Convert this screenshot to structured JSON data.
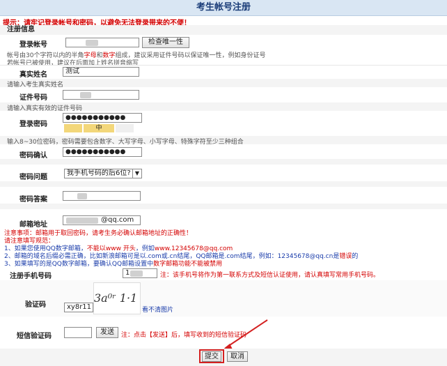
{
  "header": {
    "title": "考生帐号注册"
  },
  "tip": "提示：请牢记登录帐号和密码，以避免无法登录带来的不便！",
  "section_title": "注册信息",
  "account": {
    "label": "登录帐号",
    "check_button": "检查唯一性",
    "hint_line1_a": "帐号由30个字符以内的半角",
    "hint_line1_b": "字母",
    "hint_line1_c": "和",
    "hint_line1_d": "数字",
    "hint_line1_e": "组成，建议采用证件号码以保证唯一性，例如身份证号",
    "hint_line2": "若帐号已被使用，建议在后面加上姓名拼音缩写"
  },
  "realname": {
    "label": "真实姓名",
    "value": "测试",
    "hint": "请输入考生真实姓名"
  },
  "idnum": {
    "label": "证件号码",
    "hint": "请输入真实有效的证件号码"
  },
  "password": {
    "label": "登录密码",
    "value": "●●●●●●●●●●●",
    "strength": "中",
    "hint": "输入8~30位密码，密码需要包含数字、大写字母、小写字母、特殊字符至少三种组合"
  },
  "password_confirm": {
    "label": "密码确认",
    "value": "●●●●●●●●●●●"
  },
  "question": {
    "label": "密码问题",
    "selected": "我手机号码的后6位?"
  },
  "answer": {
    "label": "密码答案"
  },
  "email": {
    "label": "邮箱地址",
    "value": "@qq.com"
  },
  "notes": {
    "l1_a": "注意事项：邮箱用于取回密码，请考生务必确认邮箱地址的正确性！",
    "l2": "请注意填写规范：",
    "l3_a": "1、如果您使用QQ数字邮箱，",
    "l3_b": "不能以www 开头",
    "l3_c": "，例如",
    "l3_d": "www.12345678@qq.com",
    "l4_a": "2、邮箱的域名后缀必需正确，比如新浪邮箱可是以.com或.cn结尾，QQ邮箱是.com结尾，例如：12345678@qq.cn是",
    "l4_b": "错误",
    "l4_c": "的",
    "l5_a": "3、如果填写的是QQ数字邮箱，要确认QQ邮箱设置中",
    "l5_b": "数字邮箱功能不能被禁用"
  },
  "phone": {
    "label": "注册手机号码",
    "prefix": "1",
    "note": "注：该手机号将作为第一联系方式及短信认证使用，请认真填写常用手机号码。"
  },
  "captcha": {
    "label": "验证码",
    "value": "xy8r11",
    "refresh": "看不清图片",
    "image_text": "3a⁰ʳ 1·1"
  },
  "sms": {
    "label": "短信验证码",
    "send_button": "发送",
    "note": "注：点击【发送】后，填写收到的短信验证码"
  },
  "actions": {
    "submit": "提交",
    "cancel": "取消"
  },
  "colors": {
    "accent_red": "#d40000",
    "header_bg": "#d9e6f3",
    "annotation": "#d42020"
  }
}
